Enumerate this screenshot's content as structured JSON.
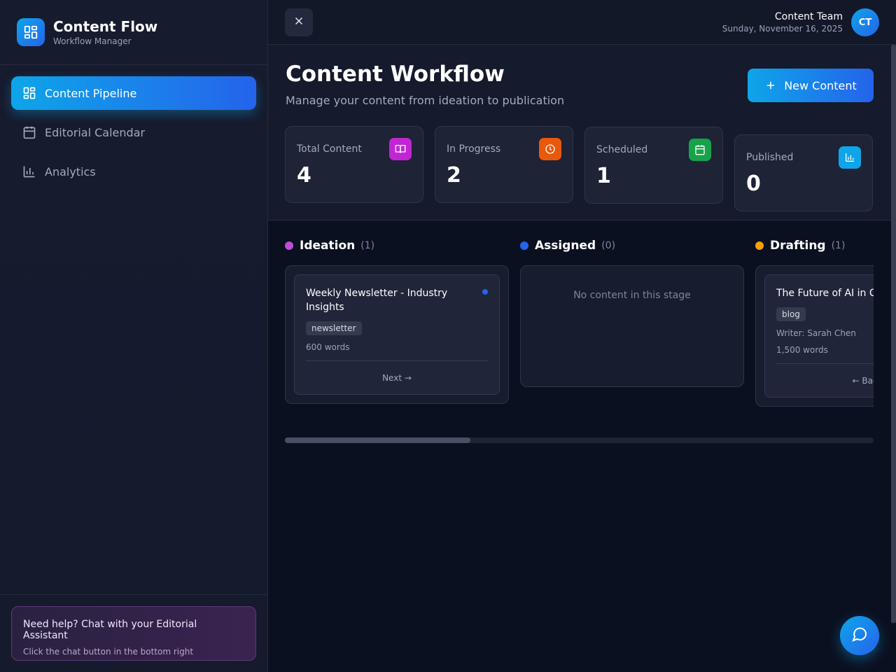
{
  "brand": {
    "title": "Content Flow",
    "subtitle": "Workflow Manager",
    "icon": "layout-grid-icon"
  },
  "sidebar": {
    "items": [
      {
        "label": "Content Pipeline",
        "icon": "layout-grid-icon",
        "active": true
      },
      {
        "label": "Editorial Calendar",
        "icon": "calendar-icon",
        "active": false
      },
      {
        "label": "Analytics",
        "icon": "bar-chart-icon",
        "active": false
      }
    ],
    "help": {
      "title": "Need help? Chat with your Editorial Assistant",
      "subtitle": "Click the chat button in the bottom right"
    }
  },
  "topbar": {
    "user_name": "Content Team",
    "date": "Sunday, November 16, 2025",
    "avatar_initials": "CT"
  },
  "header": {
    "title": "Content Workflow",
    "subtitle": "Manage your content from ideation to publication",
    "new_button": "New Content"
  },
  "stats": [
    {
      "label": "Total Content",
      "value": "4",
      "icon": "book-open-icon",
      "color": "#c026d3"
    },
    {
      "label": "In Progress",
      "value": "2",
      "icon": "clock-icon",
      "color": "#ea580c"
    },
    {
      "label": "Scheduled",
      "value": "1",
      "icon": "calendar-icon",
      "color": "#16a34a"
    },
    {
      "label": "Published",
      "value": "0",
      "icon": "bar-chart-icon",
      "color": "#0ea5e9"
    }
  ],
  "columns": [
    {
      "name": "Ideation",
      "count": "(1)",
      "color": "#c04bd6",
      "cards": [
        {
          "title": "Weekly Newsletter - Industry Insights",
          "tag": "newsletter",
          "words": "600 words",
          "action": "Next →",
          "dot_color": "#2563eb"
        }
      ]
    },
    {
      "name": "Assigned",
      "count": "(0)",
      "color": "#2563eb",
      "empty_text": "No content in this stage"
    },
    {
      "name": "Drafting",
      "count": "(1)",
      "color": "#f59e0b",
      "cards": [
        {
          "title": "The Future of AI in Content Creation",
          "tag": "blog",
          "writer": "Writer: Sarah Chen",
          "words": "1,500 words",
          "action": "← Back"
        }
      ]
    }
  ],
  "colors": {
    "accent": "#0ea5e9",
    "accent2": "#2563eb",
    "background": "#0b1020"
  }
}
